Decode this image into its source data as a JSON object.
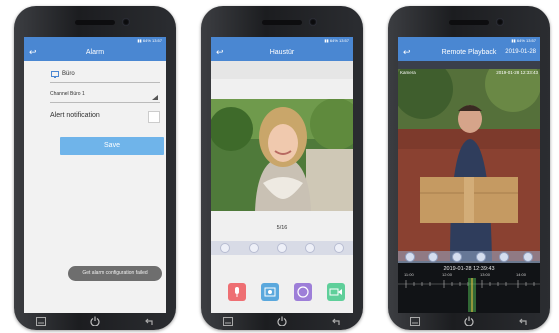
{
  "phones": [
    {
      "screen": "alarm",
      "title": "Alarm",
      "device_name": "Büro",
      "channel": "Channel Büro 1",
      "alert_label": "Alert notification",
      "save_label": "Save",
      "toast": "Get alarm configuration failed"
    },
    {
      "screen": "live",
      "title": "Haustür",
      "page_indicator": "5/16"
    },
    {
      "screen": "playback",
      "title": "Remote Playback",
      "date": "2019-01-28",
      "video_label": "Kamera",
      "video_timestamp": "2019-01-28 12:33:43",
      "timeline_datetime": "2019-01-28 12:39:43",
      "timeline_labels": [
        "11:00",
        "12:00",
        "13:00",
        "14:00"
      ]
    }
  ],
  "icons": {
    "back": "back-arrow-icon",
    "nav_home": "home-square-icon",
    "nav_power": "power-icon",
    "nav_return": "return-icon"
  },
  "colors": {
    "appbar": "#4a87d2",
    "save_button": "#6fb4ea",
    "tile_mic": "#ee6f73",
    "tile_snapshot": "#5aa8dd",
    "tile_record": "#9d7ed8",
    "tile_video": "#5fcf9a"
  }
}
